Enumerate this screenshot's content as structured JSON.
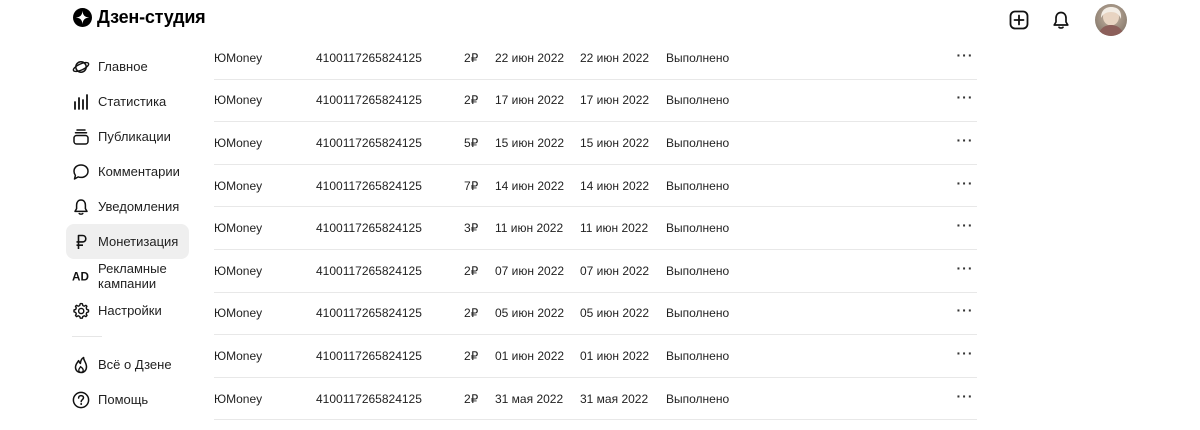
{
  "app": {
    "title": "Дзен-студия"
  },
  "header": {
    "add_icon": "plus-square-icon",
    "notifications_icon": "bell-icon"
  },
  "sidebar": {
    "items": [
      {
        "label": "Главное",
        "icon": "planet-icon",
        "active": false
      },
      {
        "label": "Статистика",
        "icon": "bars-chart-icon",
        "active": false
      },
      {
        "label": "Публикации",
        "icon": "stack-icon",
        "active": false
      },
      {
        "label": "Комментарии",
        "icon": "comment-icon",
        "active": false
      },
      {
        "label": "Уведомления",
        "icon": "bell-icon",
        "active": false
      },
      {
        "label": "Монетизация",
        "icon": "ruble-icon",
        "active": true
      },
      {
        "label": "Рекламные кампании",
        "icon": "ad-icon",
        "active": false
      },
      {
        "label": "Настройки",
        "icon": "gear-icon",
        "active": false
      }
    ],
    "footer_items": [
      {
        "label": "Всё о Дзене",
        "icon": "flame-icon"
      },
      {
        "label": "Помощь",
        "icon": "help-icon"
      }
    ]
  },
  "payouts": {
    "rows": [
      {
        "method": "ЮMoney",
        "account": "4100117265824125",
        "amount": "2₽",
        "date_created": "22 июн 2022",
        "date_paid": "22 июн 2022",
        "status": "Выполнено"
      },
      {
        "method": "ЮMoney",
        "account": "4100117265824125",
        "amount": "2₽",
        "date_created": "17 июн 2022",
        "date_paid": "17 июн 2022",
        "status": "Выполнено"
      },
      {
        "method": "ЮMoney",
        "account": "4100117265824125",
        "amount": "5₽",
        "date_created": "15 июн 2022",
        "date_paid": "15 июн 2022",
        "status": "Выполнено"
      },
      {
        "method": "ЮMoney",
        "account": "4100117265824125",
        "amount": "7₽",
        "date_created": "14 июн 2022",
        "date_paid": "14 июн 2022",
        "status": "Выполнено"
      },
      {
        "method": "ЮMoney",
        "account": "4100117265824125",
        "amount": "3₽",
        "date_created": "11 июн 2022",
        "date_paid": "11 июн 2022",
        "status": "Выполнено"
      },
      {
        "method": "ЮMoney",
        "account": "4100117265824125",
        "amount": "2₽",
        "date_created": "07 июн 2022",
        "date_paid": "07 июн 2022",
        "status": "Выполнено"
      },
      {
        "method": "ЮMoney",
        "account": "4100117265824125",
        "amount": "2₽",
        "date_created": "05 июн 2022",
        "date_paid": "05 июн 2022",
        "status": "Выполнено"
      },
      {
        "method": "ЮMoney",
        "account": "4100117265824125",
        "amount": "2₽",
        "date_created": "01 июн 2022",
        "date_paid": "01 июн 2022",
        "status": "Выполнено"
      },
      {
        "method": "ЮMoney",
        "account": "4100117265824125",
        "amount": "2₽",
        "date_created": "31 мая 2022",
        "date_paid": "31 мая 2022",
        "status": "Выполнено"
      }
    ]
  }
}
